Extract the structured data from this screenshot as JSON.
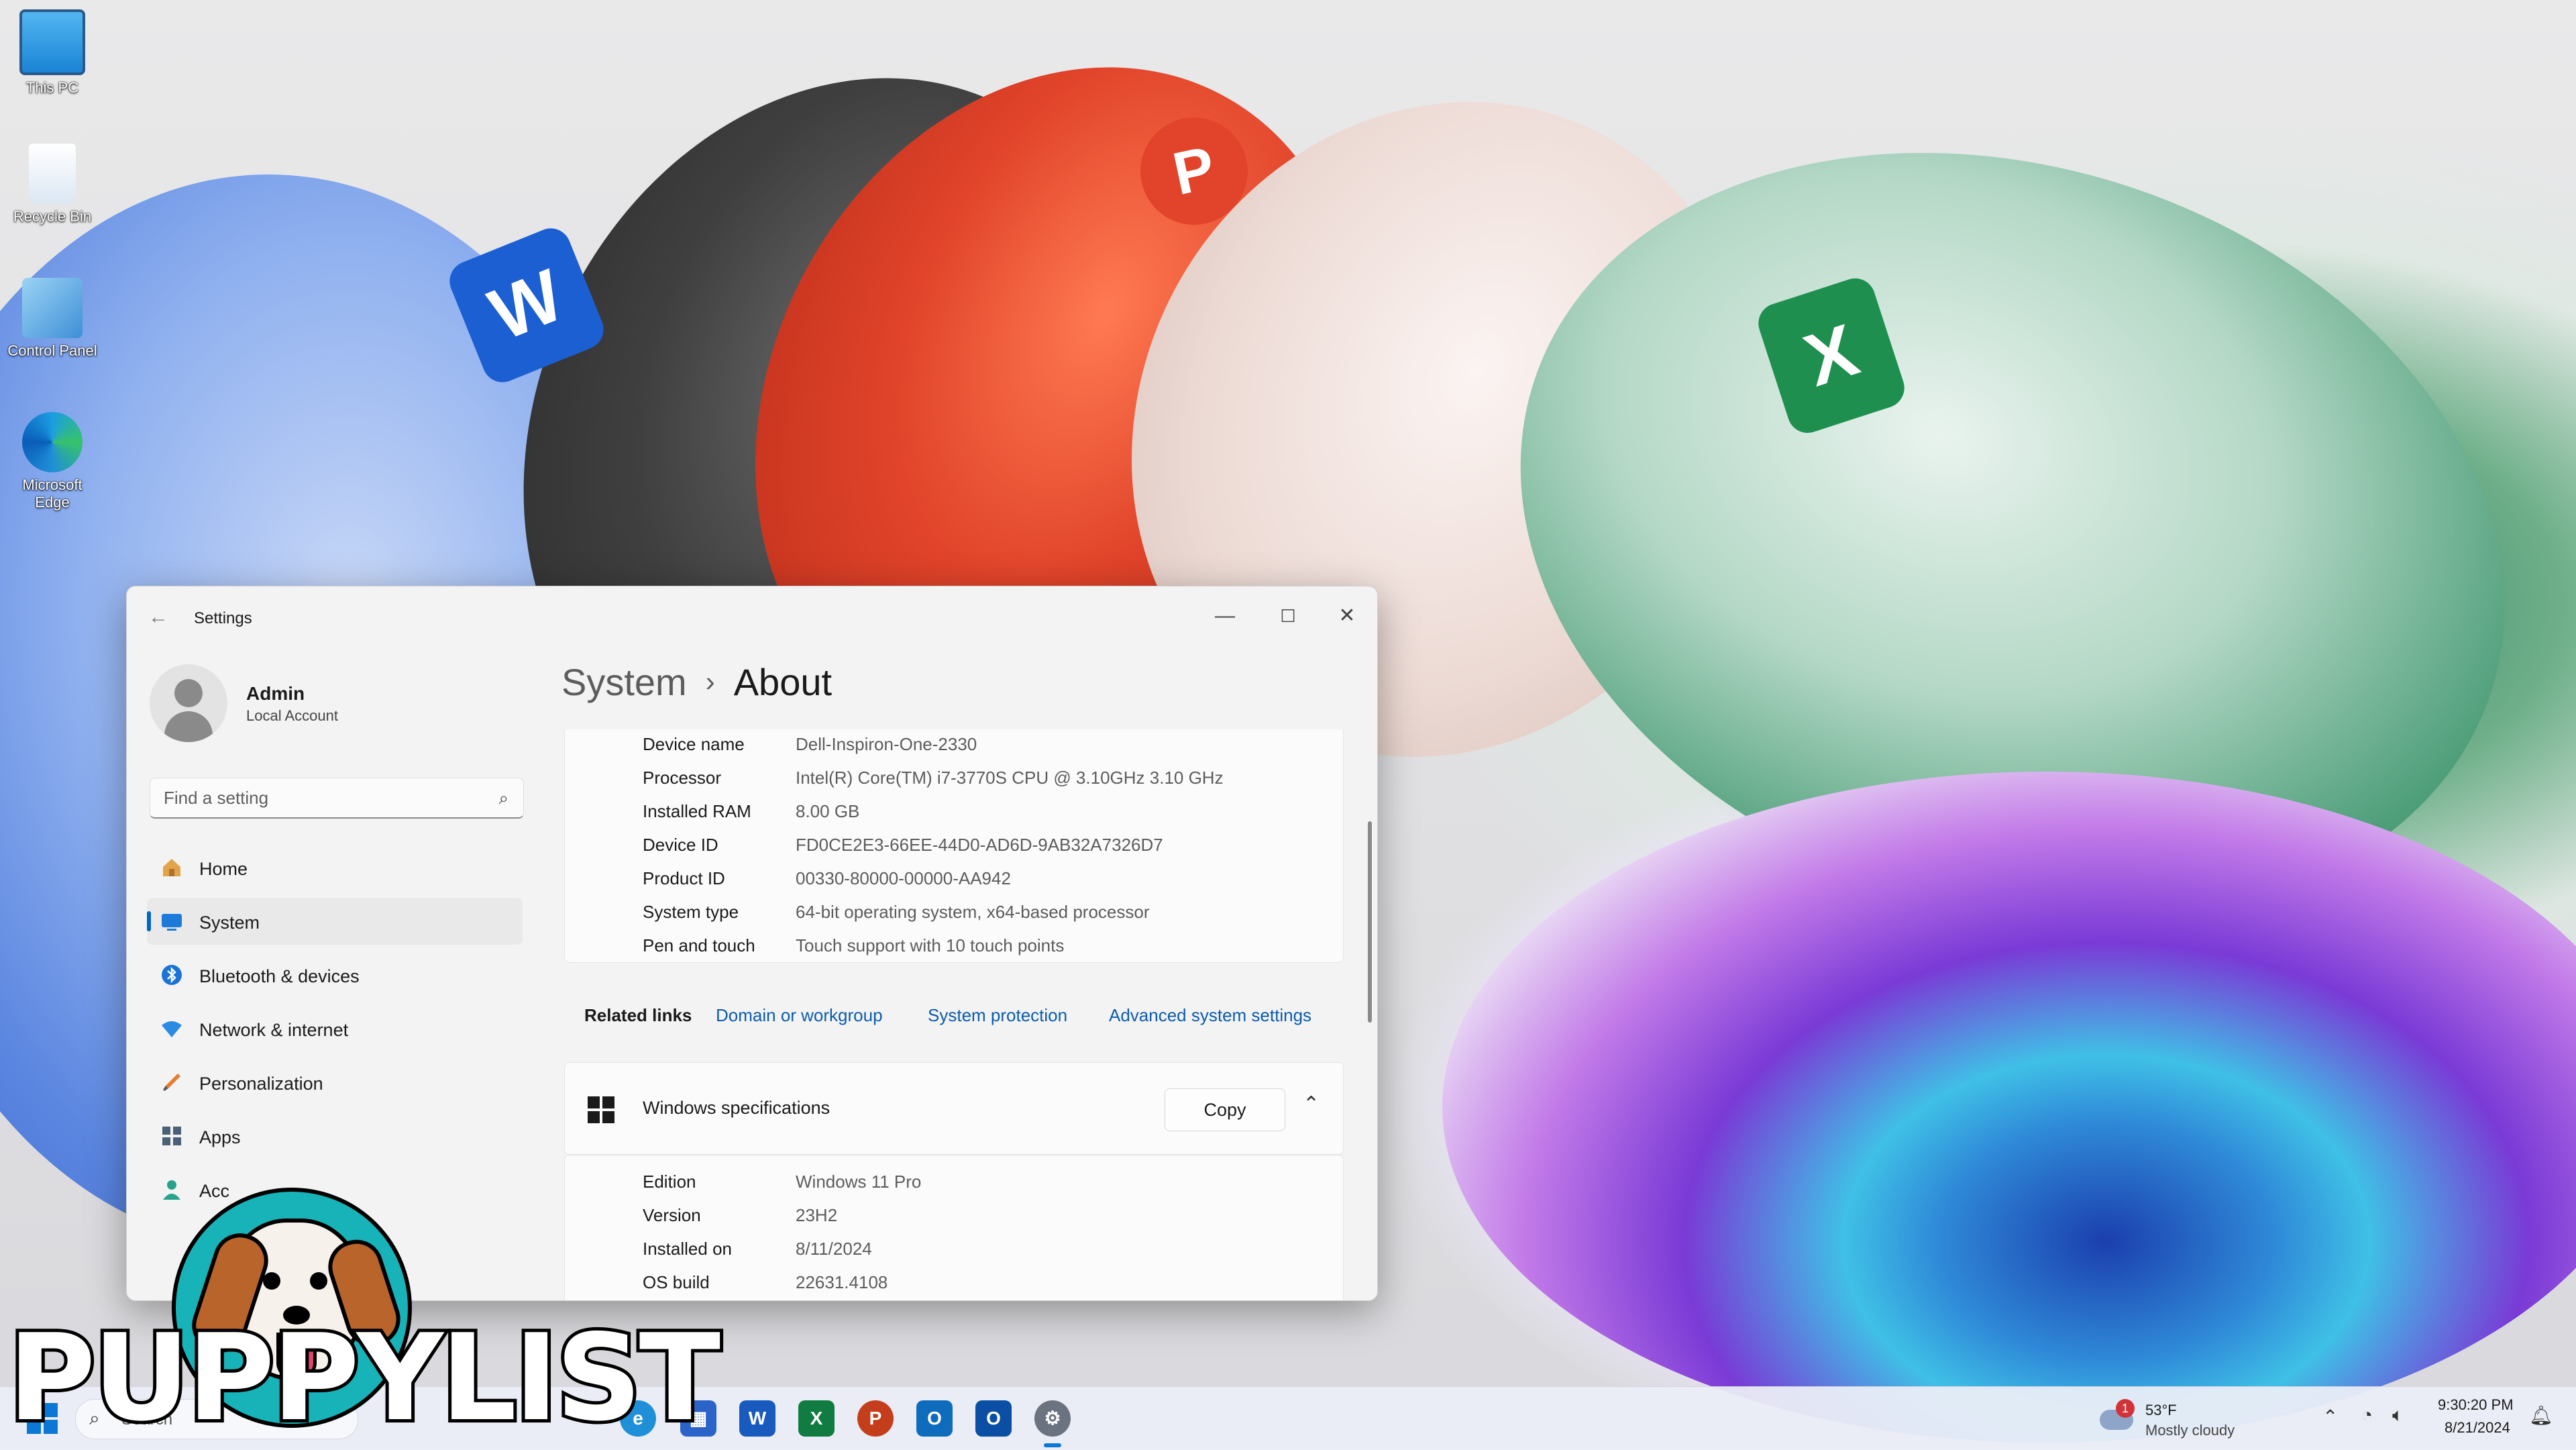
{
  "desktop": {
    "icons": [
      {
        "label": "This PC",
        "icon": "monitor-icon"
      },
      {
        "label": "Recycle Bin",
        "icon": "recycle-bin-icon"
      },
      {
        "label": "Control Panel",
        "icon": "control-panel-icon"
      },
      {
        "label": "Microsoft Edge",
        "icon": "edge-icon"
      }
    ]
  },
  "window": {
    "title": "Settings",
    "controls": {
      "minimize": "—",
      "maximize": "☐",
      "close": "✕"
    }
  },
  "profile": {
    "name": "Admin",
    "account_type": "Local Account"
  },
  "search": {
    "placeholder": "Find a setting"
  },
  "sidebar": {
    "items": [
      {
        "label": "Home",
        "icon": "home-icon",
        "color": "#e2a44b"
      },
      {
        "label": "System",
        "icon": "system-icon",
        "color": "#1d7ad8",
        "active": true
      },
      {
        "label": "Bluetooth & devices",
        "icon": "bluetooth-icon",
        "color": "#1b73d6"
      },
      {
        "label": "Network & internet",
        "icon": "wifi-icon",
        "color": "#2a8be0"
      },
      {
        "label": "Personalization",
        "icon": "brush-icon",
        "color": "#e57d32"
      },
      {
        "label": "Apps",
        "icon": "apps-icon",
        "color": "#4a6078"
      },
      {
        "label": "Acc",
        "icon": "accounts-icon",
        "color": "#26a38a"
      }
    ]
  },
  "page": {
    "breadcrumb_parent": "System",
    "breadcrumb_separator": "›",
    "title": "About"
  },
  "device_specs": [
    {
      "label": "Device name",
      "value": "Dell-Inspiron-One-2330"
    },
    {
      "label": "Processor",
      "value": "Intel(R) Core(TM) i7-3770S CPU @ 3.10GHz   3.10 GHz"
    },
    {
      "label": "Installed RAM",
      "value": "8.00 GB"
    },
    {
      "label": "Device ID",
      "value": "FD0CE2E3-66EE-44D0-AD6D-9AB32A7326D7"
    },
    {
      "label": "Product ID",
      "value": "00330-80000-00000-AA942"
    },
    {
      "label": "System type",
      "value": "64-bit operating system, x64-based processor"
    },
    {
      "label": "Pen and touch",
      "value": "Touch support with 10 touch points"
    }
  ],
  "related_links": {
    "label": "Related links",
    "links": [
      "Domain or workgroup",
      "System protection",
      "Advanced system settings"
    ]
  },
  "windows_specs": {
    "title": "Windows specifications",
    "copy_label": "Copy",
    "rows": [
      {
        "label": "Edition",
        "value": "Windows 11 Pro"
      },
      {
        "label": "Version",
        "value": "23H2"
      },
      {
        "label": "Installed on",
        "value": "8/11/2024"
      },
      {
        "label": "OS build",
        "value": "22631.4108"
      }
    ]
  },
  "taskbar": {
    "search_label": "Search",
    "apps": [
      {
        "name": "edge-icon",
        "letter": "e",
        "color": "#1f8fd8"
      },
      {
        "name": "store-icon",
        "letter": "▦",
        "color": "#2b63c9"
      },
      {
        "name": "word-icon",
        "letter": "W",
        "color": "#185abd"
      },
      {
        "name": "excel-icon",
        "letter": "X",
        "color": "#107c41"
      },
      {
        "name": "powerpoint-icon",
        "letter": "P",
        "color": "#c43e1c"
      },
      {
        "name": "outlook-new-icon",
        "letter": "O",
        "color": "#0f6cbd"
      },
      {
        "name": "outlook-icon",
        "letter": "O",
        "color": "#0a4fa3"
      },
      {
        "name": "settings-icon",
        "letter": "⚙",
        "color": "#6b7280"
      }
    ],
    "weather": {
      "badge": "1",
      "temp": "53°F",
      "condition": "Mostly cloudy"
    },
    "clock": {
      "time": "9:30:20 PM",
      "date": "8/21/2024"
    }
  },
  "watermark": {
    "text": "PUPPYLIST"
  }
}
